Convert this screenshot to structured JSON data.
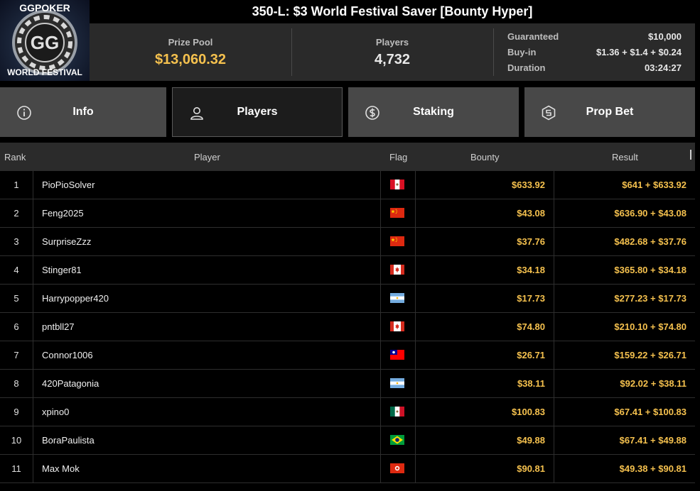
{
  "header": {
    "title": "350-L: $3 World Festival Saver [Bounty Hyper]",
    "logo_text_top": "GGPOKER",
    "logo_text_bottom": "WORLD FESTIVAL",
    "logo_mark": "GG"
  },
  "stats": {
    "prize_pool_label": "Prize Pool",
    "prize_pool_value": "$13,060.32",
    "players_label": "Players",
    "players_value": "4,732",
    "guaranteed_label": "Guaranteed",
    "guaranteed_value": "$10,000",
    "buyin_label": "Buy-in",
    "buyin_value": "$1.36 + $1.4 + $0.24",
    "duration_label": "Duration",
    "duration_value": "03:24:27"
  },
  "tabs": [
    {
      "label": "Info",
      "icon": "info-icon"
    },
    {
      "label": "Players",
      "icon": "person-icon",
      "active": true
    },
    {
      "label": "Staking",
      "icon": "dollar-coin-icon"
    },
    {
      "label": "Prop Bet",
      "icon": "prop-bet-icon"
    }
  ],
  "table": {
    "columns": {
      "rank": "Rank",
      "player": "Player",
      "flag": "Flag",
      "bounty": "Bounty",
      "result": "Result"
    },
    "rows": [
      {
        "rank": "1",
        "player": "PioPioSolver",
        "flag": "peru",
        "bounty": "$633.92",
        "result": "$641 + $633.92"
      },
      {
        "rank": "2",
        "player": "Feng2025",
        "flag": "china",
        "bounty": "$43.08",
        "result": "$636.90 + $43.08"
      },
      {
        "rank": "3",
        "player": "SurpriseZzz",
        "flag": "china",
        "bounty": "$37.76",
        "result": "$482.68 + $37.76"
      },
      {
        "rank": "4",
        "player": "Stinger81",
        "flag": "canada",
        "bounty": "$34.18",
        "result": "$365.80 + $34.18"
      },
      {
        "rank": "5",
        "player": "Harrypopper420",
        "flag": "argentina",
        "bounty": "$17.73",
        "result": "$277.23 + $17.73"
      },
      {
        "rank": "6",
        "player": "pntbll27",
        "flag": "canada",
        "bounty": "$74.80",
        "result": "$210.10 + $74.80"
      },
      {
        "rank": "7",
        "player": "Connor1006",
        "flag": "taiwan",
        "bounty": "$26.71",
        "result": "$159.22 + $26.71"
      },
      {
        "rank": "8",
        "player": "420Patagonia",
        "flag": "argentina",
        "bounty": "$38.11",
        "result": "$92.02 + $38.11"
      },
      {
        "rank": "9",
        "player": "xpino0",
        "flag": "mexico",
        "bounty": "$100.83",
        "result": "$67.41 + $100.83"
      },
      {
        "rank": "10",
        "player": "BoraPaulista",
        "flag": "brazil",
        "bounty": "$49.88",
        "result": "$67.41 + $49.88"
      },
      {
        "rank": "11",
        "player": "Max Mok",
        "flag": "hong-kong",
        "bounty": "$90.81",
        "result": "$49.38 + $90.81"
      }
    ]
  },
  "colors": {
    "accent_gold": "#f5c14e",
    "tab_bg": "#484848",
    "tab_active_bg": "#1c1c1c",
    "stats_bg": "#2a2a2a"
  }
}
